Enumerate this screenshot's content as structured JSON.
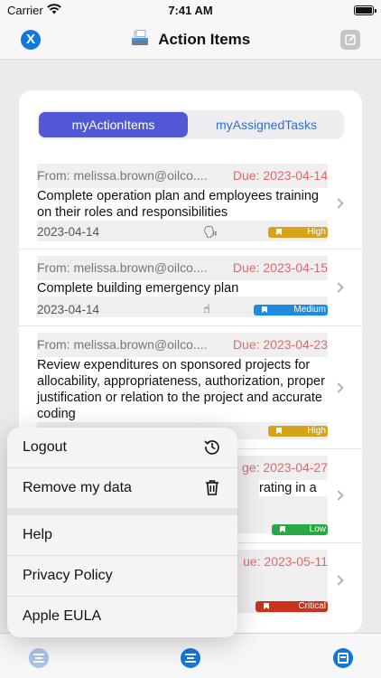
{
  "status_bar": {
    "carrier": "Carrier",
    "time": "7:41 AM"
  },
  "nav": {
    "close_label": "X",
    "title": "Action Items"
  },
  "tabs": {
    "items": [
      "myActionItems",
      "myAssignedTasks"
    ]
  },
  "list": {
    "rows": [
      {
        "from": "From: melissa.brown@oilco....",
        "due": "Due: 2023-04-14",
        "title": "Complete operation plan and employees training on their roles and responsibilities",
        "date": "2023-04-14",
        "priority": "High",
        "priority_color": "#d6a21a"
      },
      {
        "from": "From: melissa.brown@oilco....",
        "due": "Due: 2023-04-15",
        "title": "Complete building emergency plan",
        "date": "2023-04-14",
        "priority": "Medium",
        "priority_color": "#1d8be0"
      },
      {
        "from": "From: melissa.brown@oilco....",
        "due": "Due: 2023-04-23",
        "title": "Review expenditures on sponsored projects for allocability, appropriateness, authorization, proper justification or relation to the project and accurate coding",
        "date": "",
        "priority": "High",
        "priority_color": "#d6a21a"
      },
      {
        "from": "",
        "due": "ge: 2023-04-27",
        "title": "rating in a",
        "date": "",
        "priority": "Low",
        "priority_color": "#27a844"
      },
      {
        "from": "",
        "due": "ue: 2023-05-11",
        "title": "",
        "date": "",
        "priority": "Critical",
        "priority_color": "#c8321e"
      }
    ]
  },
  "menu": {
    "items": [
      {
        "label": "Logout",
        "icon": "history-icon"
      },
      {
        "label": "Remove my data",
        "icon": "trash-icon"
      },
      {
        "label": "Help",
        "icon": ""
      },
      {
        "label": "Privacy Policy",
        "icon": ""
      },
      {
        "label": "Apple EULA",
        "icon": ""
      }
    ]
  },
  "colors": {
    "accent": "#1478d9",
    "segment_active": "#5158d6",
    "due_text": "#e06a6a"
  }
}
